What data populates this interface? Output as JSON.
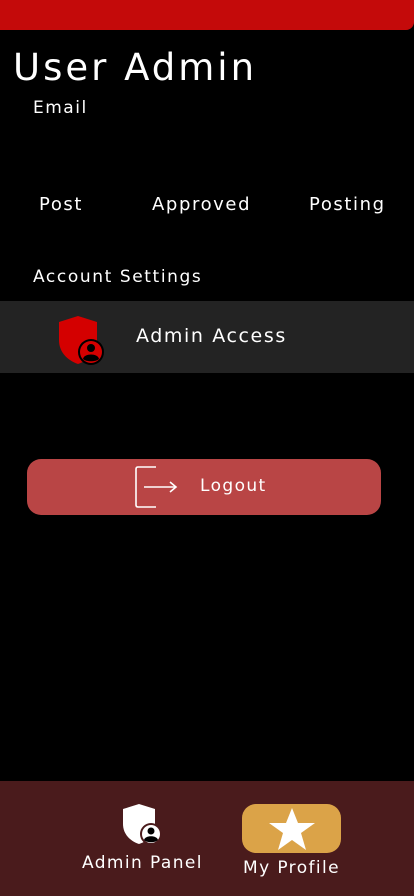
{
  "header": {
    "title": "User Admin",
    "email_label": "Email"
  },
  "stats": {
    "post_label": "Post",
    "approved_label": "Approved",
    "posting_label": "Posting"
  },
  "settings": {
    "heading": "Account Settings",
    "items": [
      {
        "label": "Admin Access",
        "icon": "admin-shield-icon"
      }
    ]
  },
  "actions": {
    "logout_label": "Logout",
    "logout_icon": "logout-icon"
  },
  "bottom_nav": {
    "items": [
      {
        "label": "Admin Panel",
        "icon": "admin-shield-icon",
        "active": false
      },
      {
        "label": "My Profile",
        "icon": "star-icon",
        "active": true
      }
    ]
  },
  "colors": {
    "background": "#000000",
    "top_bar": "#c40a0a",
    "row_background": "#232323",
    "logout_button": "#b94545",
    "bottom_nav": "#4a1b1c",
    "active_tab": "#dba348",
    "shield_red": "#d40000"
  }
}
